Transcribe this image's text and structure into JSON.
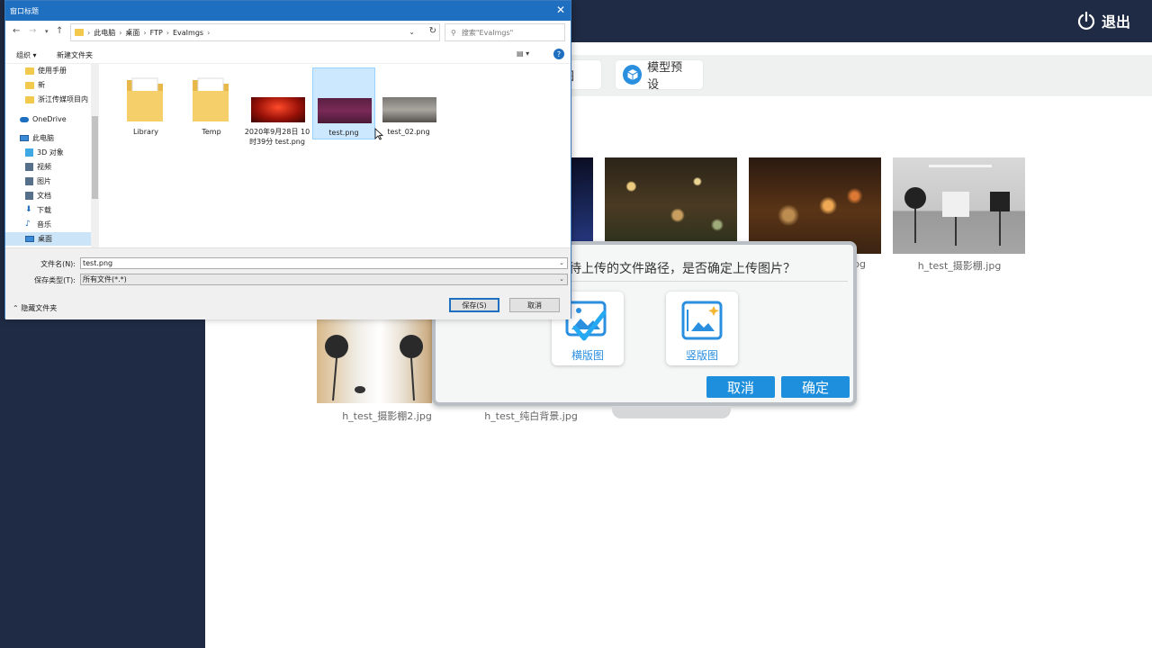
{
  "app": {
    "logout_label": "退出",
    "tabs": [
      {
        "label": "贴图"
      },
      {
        "label": "模型预设"
      }
    ],
    "images": [
      {
        "caption": "pg"
      },
      {
        "caption": "h_test_摄影棚.jpg"
      },
      {
        "caption": "h_test_摄影棚2.jpg"
      },
      {
        "caption": "h_test_纯白背景.jpg"
      }
    ]
  },
  "confirm_dialog": {
    "title": "待上传的文件路径，是否确定上传图片？",
    "landscape_label": "横版图",
    "portrait_label": "竖版图",
    "cancel_label": "取消",
    "ok_label": "确定",
    "accent_color": "#1e8fdc"
  },
  "save_dialog": {
    "title": "窗口标题",
    "breadcrumb": [
      "此电脑",
      "桌面",
      "FTP",
      "EvaImgs"
    ],
    "search_placeholder": "搜索\"EvaImgs\"",
    "organize_label": "组织 ▾",
    "new_folder_label": "新建文件夹",
    "nav_items": [
      {
        "label": "使用手册",
        "icon": "folder-icon"
      },
      {
        "label": "新",
        "icon": "folder-icon"
      },
      {
        "label": "浙江传媒项目内",
        "icon": "folder-icon"
      },
      {
        "label": "OneDrive",
        "icon": "onedrive-icon"
      },
      {
        "label": "此电脑",
        "icon": "computer-icon"
      },
      {
        "label": "3D 对象",
        "icon": "3d-objects-icon"
      },
      {
        "label": "视频",
        "icon": "video-icon"
      },
      {
        "label": "图片",
        "icon": "pictures-icon"
      },
      {
        "label": "文档",
        "icon": "documents-icon"
      },
      {
        "label": "下载",
        "icon": "download-icon"
      },
      {
        "label": "音乐",
        "icon": "music-icon"
      },
      {
        "label": "桌面",
        "icon": "desktop-icon"
      }
    ],
    "files": [
      {
        "name": "Library",
        "type": "folder"
      },
      {
        "name": "Temp",
        "type": "folder"
      },
      {
        "name": "2020年9月28日 10时39分 test.png",
        "type": "image"
      },
      {
        "name": "test.png",
        "type": "image",
        "selected": true
      },
      {
        "name": "test_02.png",
        "type": "image"
      }
    ],
    "filename_label": "文件名(N):",
    "filename_value": "test.png",
    "filetype_label": "保存类型(T):",
    "filetype_value": "所有文件(*.*)",
    "save_label": "保存(S)",
    "cancel_label": "取消",
    "hide_folders_label": "隐藏文件夹",
    "accent_color": "#1f6fc0"
  }
}
